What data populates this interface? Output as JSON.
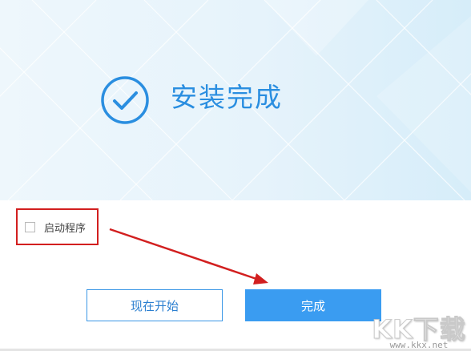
{
  "banner": {
    "title": "安装完成",
    "icon": "check-circle-icon",
    "accent_color": "#2a8ee0"
  },
  "options": {
    "launch_label": "启动程序",
    "launch_checked": false
  },
  "buttons": {
    "start_now": "现在开始",
    "finish": "完成"
  },
  "watermark": {
    "logo_text": "KK下载",
    "url": "www.kkx.net"
  },
  "colors": {
    "primary": "#3a9cf1",
    "highlight_box": "#d21f1f",
    "arrow": "#d21f1f"
  }
}
